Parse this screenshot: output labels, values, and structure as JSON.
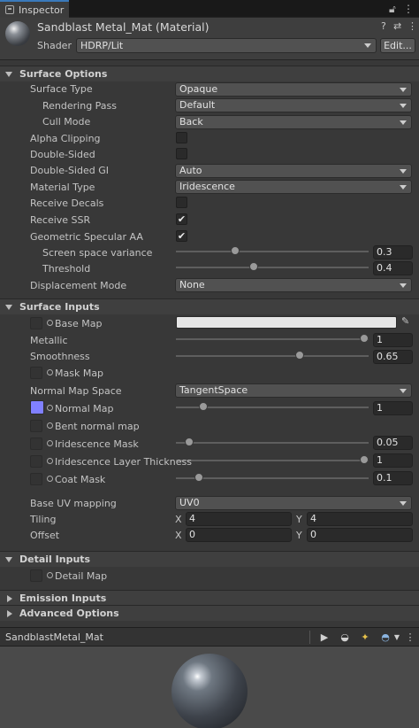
{
  "tab": {
    "label": "Inspector"
  },
  "header": {
    "title": "Sandblast Metal_Mat (Material)",
    "shader_label": "Shader",
    "shader_value": "HDRP/Lit",
    "edit_label": "Edit..."
  },
  "surface_options": {
    "title": "Surface Options",
    "surface_type": {
      "label": "Surface Type",
      "value": "Opaque"
    },
    "rendering_pass": {
      "label": "Rendering Pass",
      "value": "Default"
    },
    "cull_mode": {
      "label": "Cull Mode",
      "value": "Back"
    },
    "alpha_clipping": {
      "label": "Alpha Clipping",
      "checked": false
    },
    "double_sided": {
      "label": "Double-Sided",
      "checked": false
    },
    "double_sided_gi": {
      "label": "Double-Sided GI",
      "value": "Auto"
    },
    "material_type": {
      "label": "Material Type",
      "value": "Iridescence"
    },
    "receive_decals": {
      "label": "Receive Decals",
      "checked": false
    },
    "receive_ssr": {
      "label": "Receive SSR",
      "checked": true,
      "mark": "✔"
    },
    "geometric_specular_aa": {
      "label": "Geometric Specular AA",
      "checked": true,
      "mark": "✔"
    },
    "screen_space_variance": {
      "label": "Screen space variance",
      "value": "0.3",
      "fraction": 0.3
    },
    "threshold": {
      "label": "Threshold",
      "value": "0.4",
      "fraction": 0.4
    },
    "displacement_mode": {
      "label": "Displacement Mode",
      "value": "None"
    }
  },
  "surface_inputs": {
    "title": "Surface Inputs",
    "base_map": {
      "label": "Base Map",
      "color": "#e6e6e6"
    },
    "metallic": {
      "label": "Metallic",
      "value": "1",
      "fraction": 1.0
    },
    "smoothness": {
      "label": "Smoothness",
      "value": "0.65",
      "fraction": 0.65
    },
    "mask_map": {
      "label": "Mask Map"
    },
    "normal_map_space": {
      "label": "Normal Map Space",
      "value": "TangentSpace"
    },
    "normal_map": {
      "label": "Normal Map",
      "value": "1",
      "fraction": 0.125,
      "thumb_color": "#8080ff"
    },
    "bent_normal_map": {
      "label": "Bent normal map"
    },
    "iridescence_mask": {
      "label": "Iridescence Mask",
      "value": "0.05",
      "fraction": 0.05
    },
    "iridescence_layer_thickness": {
      "label": "Iridescence Layer Thickness",
      "value": "1",
      "fraction": 1.0
    },
    "coat_mask": {
      "label": "Coat Mask",
      "value": "0.1",
      "fraction": 0.1
    },
    "base_uv_mapping": {
      "label": "Base UV mapping",
      "value": "UV0"
    },
    "tiling": {
      "label": "Tiling",
      "x_label": "X",
      "x": "4",
      "y_label": "Y",
      "y": "4"
    },
    "offset": {
      "label": "Offset",
      "x_label": "X",
      "x": "0",
      "y_label": "Y",
      "y": "0"
    }
  },
  "detail_inputs": {
    "title": "Detail Inputs",
    "detail_map": {
      "label": "Detail Map"
    }
  },
  "emission_inputs": {
    "title": "Emission Inputs"
  },
  "advanced_options": {
    "title": "Advanced Options"
  },
  "preview": {
    "title": "SandblastMetal_Mat"
  },
  "colors": {
    "accent": "#3a79bb",
    "panel": "#383838",
    "field": "#515151"
  }
}
